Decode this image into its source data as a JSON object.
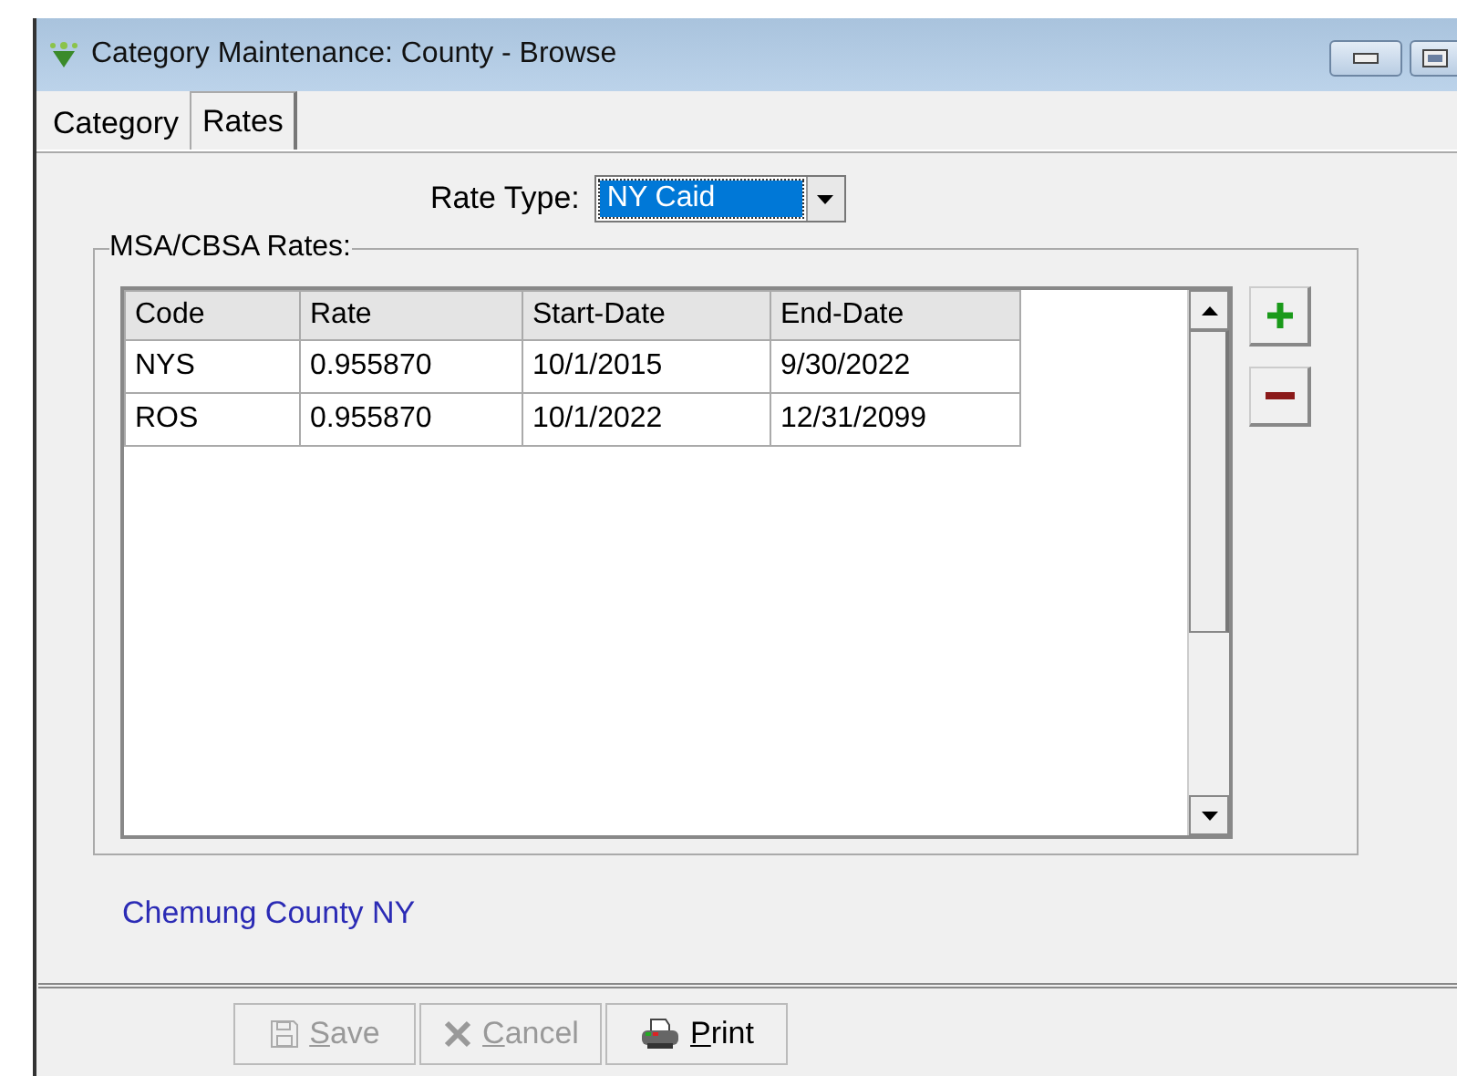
{
  "window": {
    "title": "Category Maintenance: County - Browse"
  },
  "tabs": [
    {
      "label": "Category",
      "selected": false
    },
    {
      "label": "Rates",
      "selected": true
    }
  ],
  "rate_type": {
    "label": "Rate Type:",
    "value": "NY Caid"
  },
  "group": {
    "title": "MSA/CBSA Rates:"
  },
  "table": {
    "columns": [
      "Code",
      "Rate",
      "Start-Date",
      "End-Date"
    ],
    "rows": [
      [
        "NYS",
        "0.955870",
        "10/1/2015",
        "9/30/2022"
      ],
      [
        "ROS",
        "0.955870",
        "10/1/2022",
        "12/31/2099"
      ]
    ]
  },
  "county_label": "Chemung County NY",
  "buttons": [
    {
      "kind": "save",
      "label": "Save",
      "disabled": true
    },
    {
      "kind": "cancel",
      "label": "Cancel",
      "disabled": true
    },
    {
      "kind": "print",
      "label": "Print",
      "disabled": false
    }
  ]
}
